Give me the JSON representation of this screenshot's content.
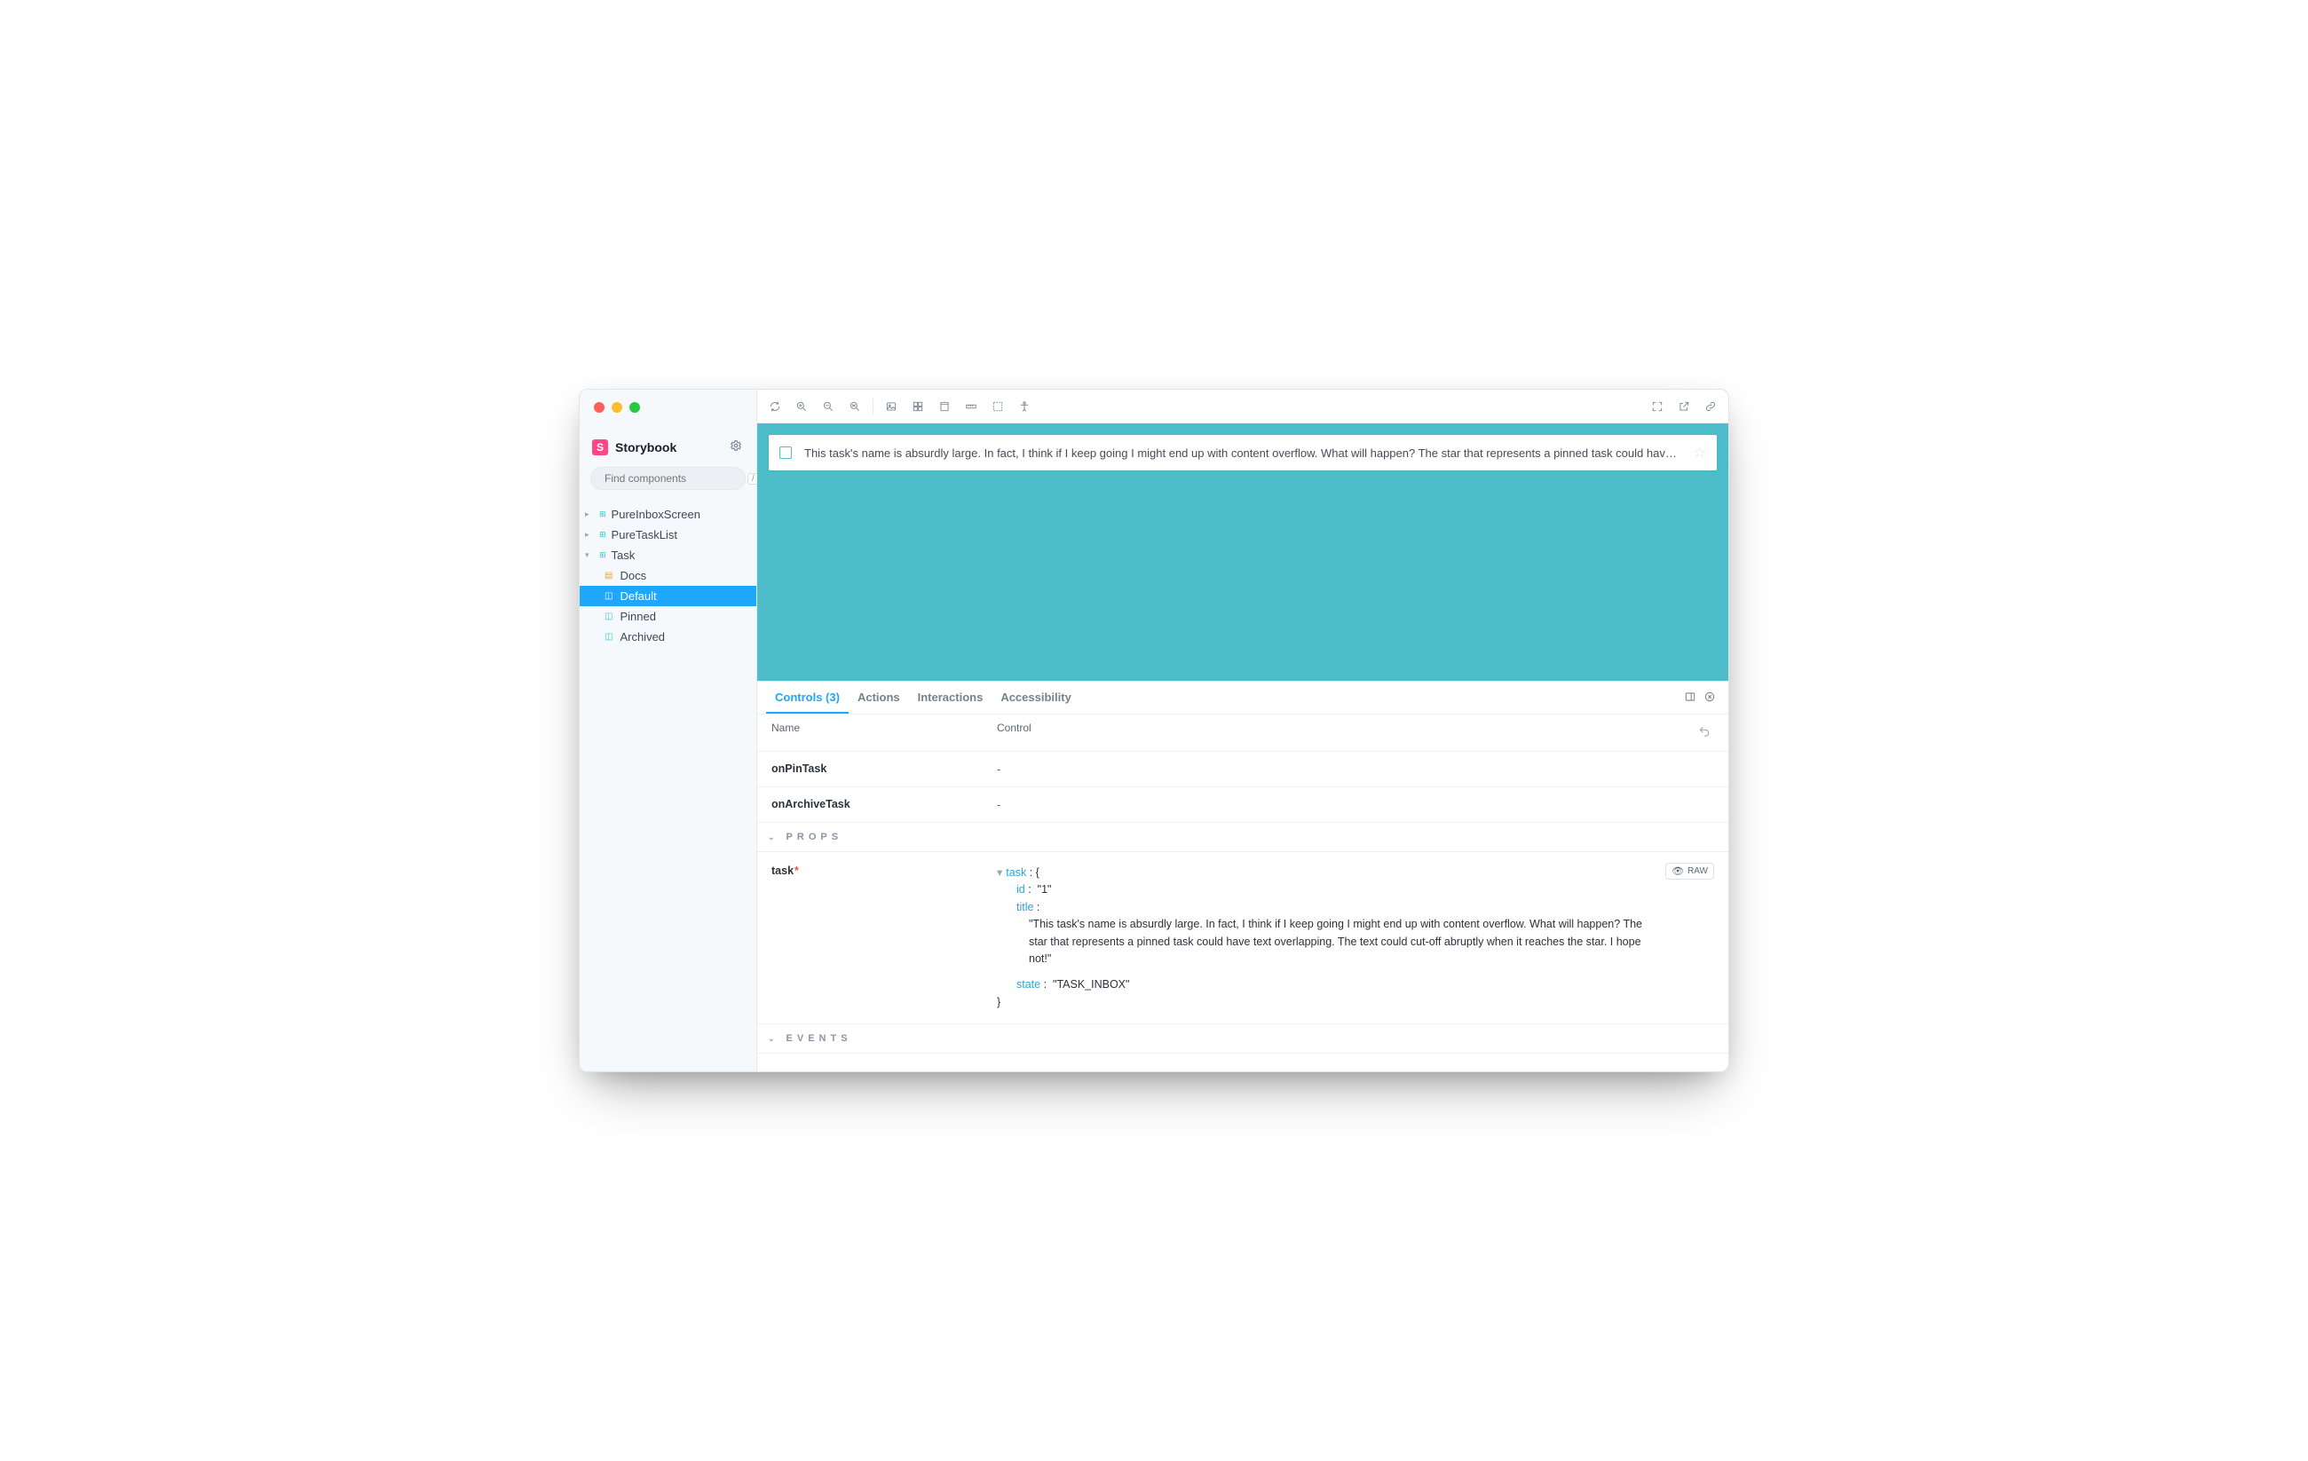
{
  "brand": {
    "logo_letter": "S",
    "name": "Storybook"
  },
  "search": {
    "placeholder": "Find components",
    "shortcut": "/"
  },
  "sidebar": {
    "items": [
      {
        "label": "PureInboxScreen",
        "expanded": false
      },
      {
        "label": "PureTaskList",
        "expanded": false
      },
      {
        "label": "Task",
        "expanded": true,
        "children": [
          {
            "label": "Docs",
            "type": "docs"
          },
          {
            "label": "Default",
            "type": "story",
            "selected": true
          },
          {
            "label": "Pinned",
            "type": "story"
          },
          {
            "label": "Archived",
            "type": "story"
          }
        ]
      }
    ]
  },
  "canvas_bg": "#4dbec9",
  "task_card": {
    "title": "This task's name is absurdly large. In fact, I think if I keep going I might end up with content overflow. What will happen? The star that represents a pinned task could have text"
  },
  "addons": {
    "tabs": [
      {
        "label": "Controls (3)",
        "active": true
      },
      {
        "label": "Actions"
      },
      {
        "label": "Interactions"
      },
      {
        "label": "Accessibility"
      }
    ],
    "headers": {
      "name": "Name",
      "control": "Control"
    },
    "rows": [
      {
        "name": "onPinTask",
        "control": "-"
      },
      {
        "name": "onArchiveTask",
        "control": "-"
      }
    ],
    "sections": {
      "props": "PROPS",
      "events": "EVENTS"
    },
    "prop": {
      "name": "task",
      "required": true,
      "root_key": "task",
      "id_key": "id",
      "id_val": "\"1\"",
      "title_key": "title",
      "title_val": "\"This task's name is absurdly large. In fact, I think if I keep going I might end up with content overflow. What will happen? The star that represents a pinned task could have text overlapping. The text could cut-off abruptly when it reaches the star. I hope not!\"",
      "state_key": "state",
      "state_val": "\"TASK_INBOX\""
    },
    "raw_label": "RAW"
  }
}
